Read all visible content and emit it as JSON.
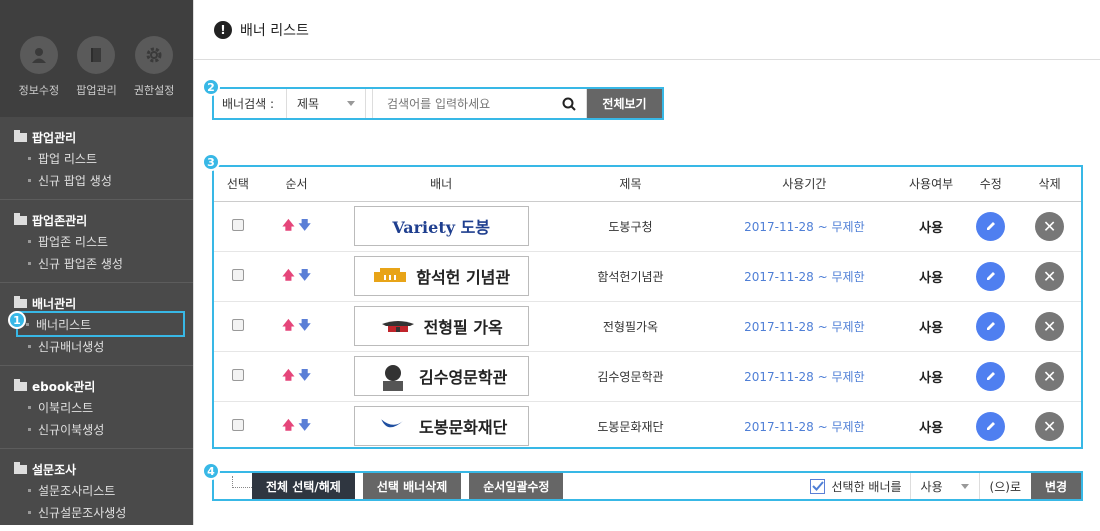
{
  "sidebar": {
    "top_icons": [
      {
        "label": "정보수정",
        "icon": "user-icon"
      },
      {
        "label": "팝업관리",
        "icon": "book-icon"
      },
      {
        "label": "권한설정",
        "icon": "gear-icon"
      }
    ],
    "groups": [
      {
        "title": "팝업관리",
        "items": [
          "팝업 리스트",
          "신규 팝업 생성"
        ]
      },
      {
        "title": "팝업존관리",
        "items": [
          "팝업존 리스트",
          "신규 팝업존 생성"
        ]
      },
      {
        "title": "배너관리",
        "items": [
          "배너리스트",
          "신규배너생성"
        ]
      },
      {
        "title": "ebook관리",
        "items": [
          "이북리스트",
          "신규이북생성"
        ]
      },
      {
        "title": "설문조사",
        "items": [
          "설문조사리스트",
          "신규설문조사생성"
        ]
      }
    ]
  },
  "callouts": [
    "1",
    "2",
    "3",
    "4"
  ],
  "header": {
    "bang": "!",
    "title": "배너 리스트"
  },
  "search": {
    "label": "배너검색 :",
    "select_value": "제목",
    "placeholder": "검색어를 입력하세요",
    "all_button": "전체보기"
  },
  "table": {
    "headers": [
      "선택",
      "순서",
      "배너",
      "제목",
      "사용기간",
      "사용여부",
      "수정",
      "삭제"
    ],
    "rows": [
      {
        "banner": "Variety 도봉",
        "title": "도봉구청",
        "period": "2017-11-28 ~ 무제한",
        "status": "사용"
      },
      {
        "banner": "함석헌 기념관",
        "title": "함석헌기념관",
        "period": "2017-11-28 ~ 무제한",
        "status": "사용"
      },
      {
        "banner": "전형필 가옥",
        "title": "전형필가옥",
        "period": "2017-11-28 ~ 무제한",
        "status": "사용"
      },
      {
        "banner": "김수영문학관",
        "title": "김수영문학관",
        "period": "2017-11-28 ~ 무제한",
        "status": "사용"
      },
      {
        "banner": "도봉문화재단",
        "title": "도봉문화재단",
        "period": "2017-11-28 ~ 무제한",
        "status": "사용"
      }
    ]
  },
  "bottom": {
    "select_all": "전체 선택/해제",
    "delete_selected": "선택 배너삭제",
    "bulk_order": "순서일괄수정",
    "selected_label": "선택한 배너를",
    "select_value": "사용",
    "suffix": "(으)로",
    "change": "변경"
  },
  "colors": {
    "accent": "#38b8e6",
    "sidebar": "#4a4a4a",
    "edit": "#4f7ff0",
    "date": "#4f7fd6"
  }
}
